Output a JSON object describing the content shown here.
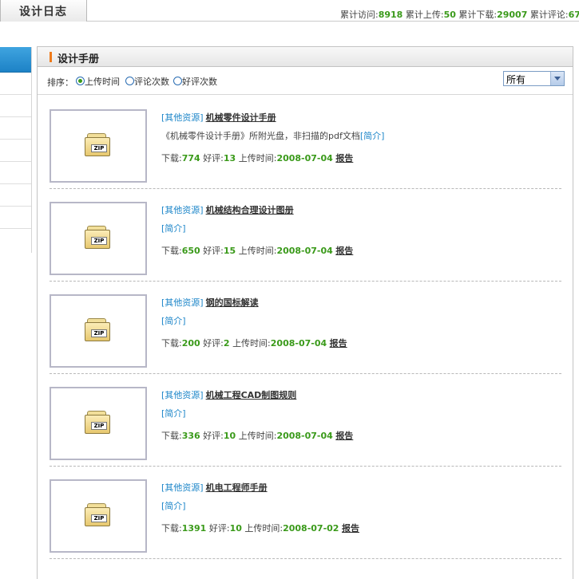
{
  "top_tab": "设计日志",
  "stats": {
    "visits_label": "累计访问:",
    "visits": "8918",
    "uploads_label": "累计上传:",
    "uploads": "50",
    "downloads_label": "累计下载:",
    "downloads": "29007",
    "comments_label": "累计评论:",
    "comments": "67"
  },
  "panel": {
    "title": "设计手册",
    "sort_label": "排序：",
    "sort_options": [
      "上传时间",
      "评论次数",
      "好评次数"
    ],
    "filter_selected": "所有"
  },
  "labels": {
    "downloads": "下载:",
    "likes": "好评:",
    "upload_time": "上传时间:",
    "report": "报告",
    "brief": "[简介]",
    "zip": "ZIP"
  },
  "items": [
    {
      "category": "[其他资源]",
      "title": "机械零件设计手册",
      "desc": "《机械零件设计手册》所附光盘，非扫描的pdf文档",
      "downloads": "774",
      "likes": "13",
      "date": "2008-07-04"
    },
    {
      "category": "[其他资源]",
      "title": "机械结构合理设计图册",
      "desc": "",
      "downloads": "650",
      "likes": "15",
      "date": "2008-07-04"
    },
    {
      "category": "[其他资源]",
      "title": "钢的国标解读",
      "desc": "",
      "downloads": "200",
      "likes": "2",
      "date": "2008-07-04"
    },
    {
      "category": "[其他资源]",
      "title": "机械工程CAD制图规则",
      "desc": "",
      "downloads": "336",
      "likes": "10",
      "date": "2008-07-04"
    },
    {
      "category": "[其他资源]",
      "title": "机电工程师手册",
      "desc": "",
      "downloads": "1391",
      "likes": "10",
      "date": "2008-07-02"
    }
  ]
}
